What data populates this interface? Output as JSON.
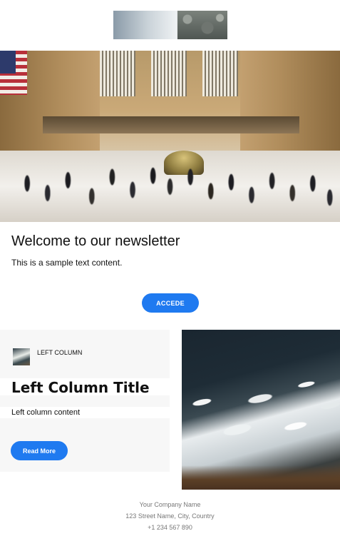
{
  "newsletter": {
    "title": "Welcome to our newsletter",
    "intro": "This is a sample text content.",
    "cta_label": "ACCEDE"
  },
  "left_column": {
    "label": "LEFT COLUMN",
    "title": "Left Column Title",
    "content": "Left column content",
    "button_label": "Read More"
  },
  "footer": {
    "company": "Your Company Name",
    "address": "123 Street Name, City, Country",
    "phone": "+1 234 567 890"
  },
  "colors": {
    "accent": "#1f7af0",
    "panel_bg": "#f7f7f7",
    "footer_text": "#777777"
  }
}
